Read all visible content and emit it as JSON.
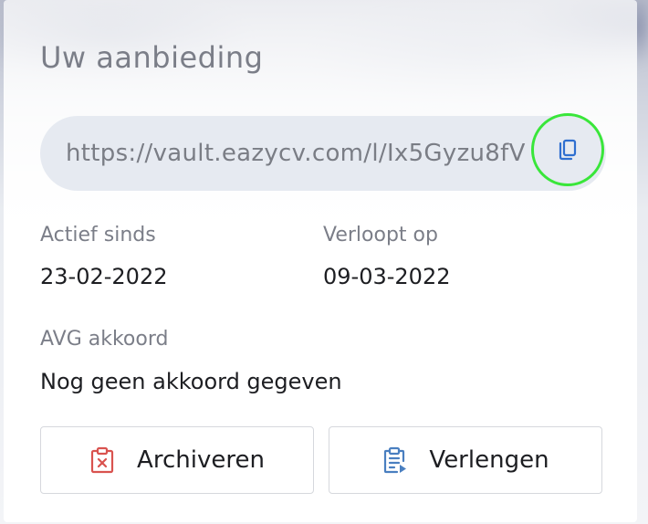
{
  "panel": {
    "title": "Uw aanbieding"
  },
  "link": {
    "url": "https://vault.eazycv.com/l/Ix5Gyzu8fV",
    "copy_icon": "copy-icon"
  },
  "details": {
    "active_since_label": "Actief sinds",
    "active_since_value": "23-02-2022",
    "expires_label": "Verloopt op",
    "expires_value": "09-03-2022",
    "gdpr_label": "AVG akkoord",
    "gdpr_value": "Nog geen akkoord gegeven"
  },
  "actions": {
    "archive_label": "Archiveren",
    "archive_icon": "clipboard-x-icon",
    "extend_label": "Verlengen",
    "extend_icon": "clipboard-play-icon"
  },
  "colors": {
    "highlight_ring": "#39e63a",
    "copy_icon": "#2f6fd0",
    "archive_icon": "#d9534f",
    "extend_icon": "#4a7fc0"
  }
}
